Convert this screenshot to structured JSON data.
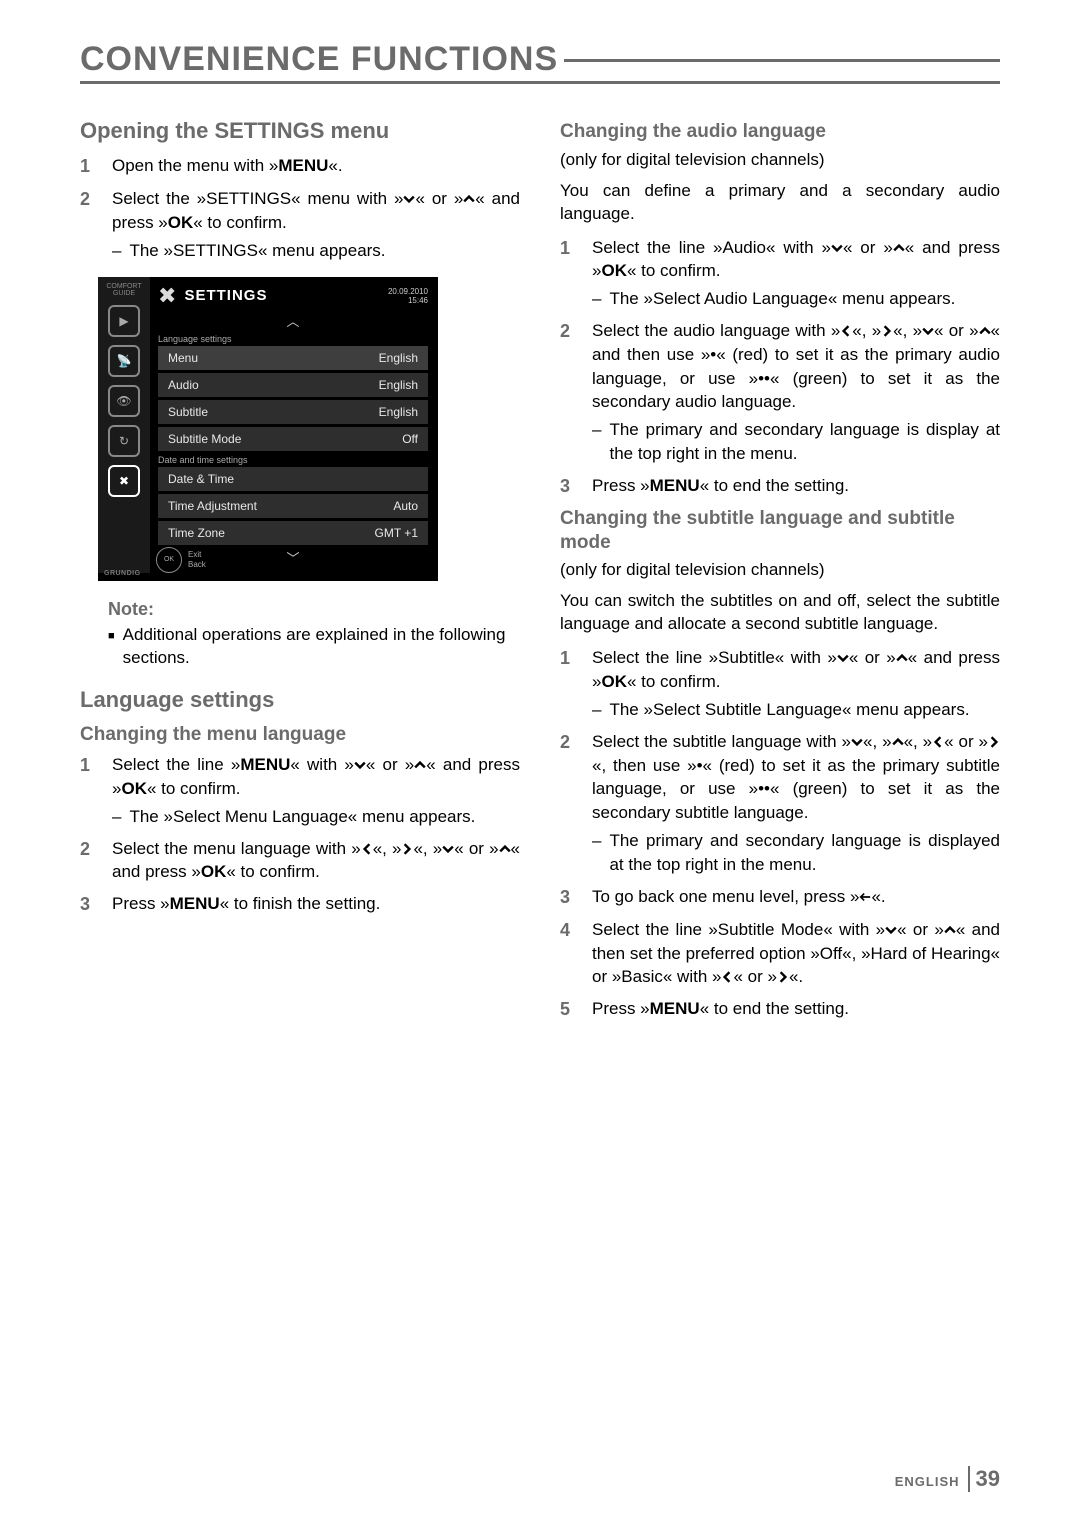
{
  "page_title": "CONVENIENCE FUNCTIONS",
  "footer": {
    "lang": "ENGLISH",
    "page": "39"
  },
  "left": {
    "h_open": "Opening the SETTINGS menu",
    "open_steps": [
      {
        "n": "1",
        "text": "Open the menu with »<b>MENU</b>«."
      },
      {
        "n": "2",
        "text": "Select the »SETTINGS« menu with »∨« or »∧« and press »<b>OK</b>« to confirm.",
        "sub": [
          "The »SETTINGS« menu appears."
        ]
      }
    ],
    "note_head": "Note:",
    "note_body": "Additional operations are explained in the following sections.",
    "h_lang": "Language settings",
    "h_menu_lang": "Changing the menu language",
    "menu_lang_steps": [
      {
        "n": "1",
        "text": "Select the line »<b>MENU</b>« with »∨« or »∧« and press »<b>OK</b>« to confirm.",
        "sub": [
          "The »Select Menu Language« menu appears."
        ]
      },
      {
        "n": "2",
        "text": "Select the menu language with »<«, »>«, »∨« or »∧« and press »<b>OK</b>« to confirm."
      },
      {
        "n": "3",
        "text": "Press »<b>MENU</b>« to finish the setting."
      }
    ]
  },
  "right": {
    "h_audio": "Changing the audio language",
    "audio_sub": "(only for digital television channels)",
    "audio_intro": "You can define a primary and a secondary audio language.",
    "audio_steps": [
      {
        "n": "1",
        "text": "Select the line »Audio« with »∨« or »∧« and press »<b>OK</b>« to confirm.",
        "sub": [
          "The »Select Audio Language« menu appears."
        ]
      },
      {
        "n": "2",
        "text": "Select the audio language with »<«, »>«, »∨« or »∧« and then use »•« (red) to set it as the primary audio language, or use »••« (green) to set it as the secondary audio language.",
        "sub": [
          "The primary and secondary language is display at the top right in the menu."
        ]
      },
      {
        "n": "3",
        "text": "Press »<b>MENU</b>« to end the setting."
      }
    ],
    "h_subtitle": "Changing the subtitle language and subtitle mode",
    "subtitle_sub": "(only for digital television channels)",
    "subtitle_intro": "You can switch the subtitles on and off, select the subtitle language and allocate a second subtitle language.",
    "subtitle_steps": [
      {
        "n": "1",
        "text": "Select the line »Subtitle« with »∨« or »∧« and press »<b>OK</b>« to confirm.",
        "sub": [
          "The »Select Subtitle Language« menu appears."
        ]
      },
      {
        "n": "2",
        "text": "Select the subtitle language with »∨«, »∧«, »<« or »>«, then use »•« (red) to set it as the primary subtitle language, or use »••« (green) to set it as the secondary subtitle language.",
        "sub": [
          "The primary and secondary language is displayed at the top right in the menu."
        ]
      },
      {
        "n": "3",
        "text": "To go back one menu level, press »⯇«."
      },
      {
        "n": "4",
        "text": "Select the line »Subtitle Mode« with »∨« or »∧« and then set the preferred option »Off«, »Hard of Hearing« or »Basic« with »<« or »>«."
      },
      {
        "n": "5",
        "text": "Press »<b>MENU</b>« to end the setting."
      }
    ]
  },
  "tv": {
    "sidebar_label": "COMFORT GUIDE",
    "title": "SETTINGS",
    "date": "20.09.2010",
    "time": "15:46",
    "section1": "Language settings",
    "section2": "Date and time settings",
    "rows": [
      {
        "label": "Menu",
        "value": "English"
      },
      {
        "label": "Audio",
        "value": "English"
      },
      {
        "label": "Subtitle",
        "value": "English"
      },
      {
        "label": "Subtitle Mode",
        "value": "Off"
      },
      {
        "label": "Date & Time",
        "value": ""
      },
      {
        "label": "Time Adjustment",
        "value": "Auto"
      },
      {
        "label": "Time Zone",
        "value": "GMT +1"
      }
    ],
    "exit": "Exit",
    "back": "Back",
    "brand": "GRUNDIG"
  }
}
